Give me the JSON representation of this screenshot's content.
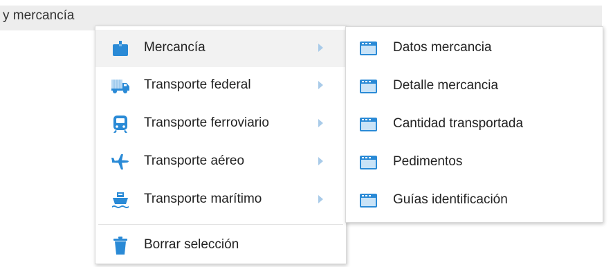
{
  "menubar": {
    "text": "y mercancía"
  },
  "main_menu": {
    "items": [
      {
        "label": "Mercancía",
        "icon": "package-icon",
        "has_submenu": true,
        "active": true
      },
      {
        "label": "Transporte federal",
        "icon": "truck-icon",
        "has_submenu": true
      },
      {
        "label": "Transporte ferroviario",
        "icon": "train-icon",
        "has_submenu": true
      },
      {
        "label": "Transporte aéreo",
        "icon": "airplane-icon",
        "has_submenu": true
      },
      {
        "label": "Transporte marítimo",
        "icon": "ship-icon",
        "has_submenu": true
      }
    ],
    "clear": {
      "label": "Borrar selección",
      "icon": "trash-icon"
    }
  },
  "submenu": {
    "items": [
      {
        "label": "Datos mercancia",
        "icon": "window-icon"
      },
      {
        "label": "Detalle mercancia",
        "icon": "window-icon"
      },
      {
        "label": "Cantidad transportada",
        "icon": "window-icon"
      },
      {
        "label": "Pedimentos",
        "icon": "window-icon"
      },
      {
        "label": "Guías identificación",
        "icon": "window-icon"
      }
    ]
  },
  "colors": {
    "icon_blue": "#2a8ad6",
    "icon_light": "#c9e3f7",
    "arrow": "#a9cbe9",
    "hover_bg": "#f2f2f2",
    "menubar_bg": "#ededed"
  }
}
